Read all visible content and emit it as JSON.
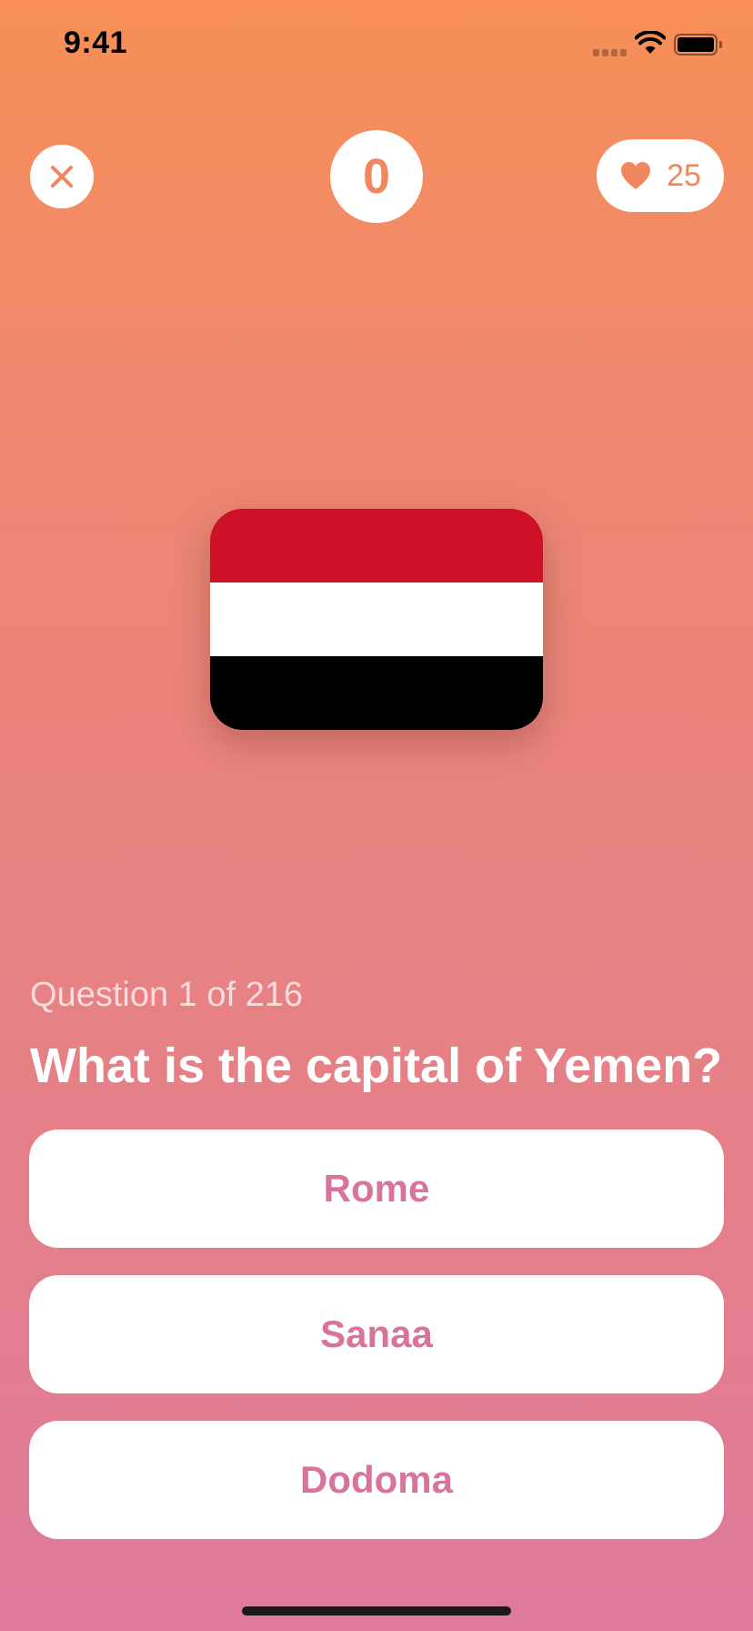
{
  "status_bar": {
    "time": "9:41"
  },
  "header": {
    "close_icon": "close-icon",
    "score": "0",
    "lives_icon": "heart-icon",
    "lives": "25"
  },
  "flag": {
    "country": "Yemen",
    "colors": [
      "#CE1126",
      "#FFFFFF",
      "#000000"
    ]
  },
  "question": {
    "counter": "Question 1 of 216",
    "text": "What is the capital of Yemen?"
  },
  "answers": [
    {
      "label": "Rome"
    },
    {
      "label": "Sanaa"
    },
    {
      "label": "Dodoma"
    }
  ],
  "colors": {
    "accent": "#F0875E",
    "answer_text": "#D8739C",
    "gradient_top": "#F78F56",
    "gradient_bottom": "#DE7A9B"
  }
}
